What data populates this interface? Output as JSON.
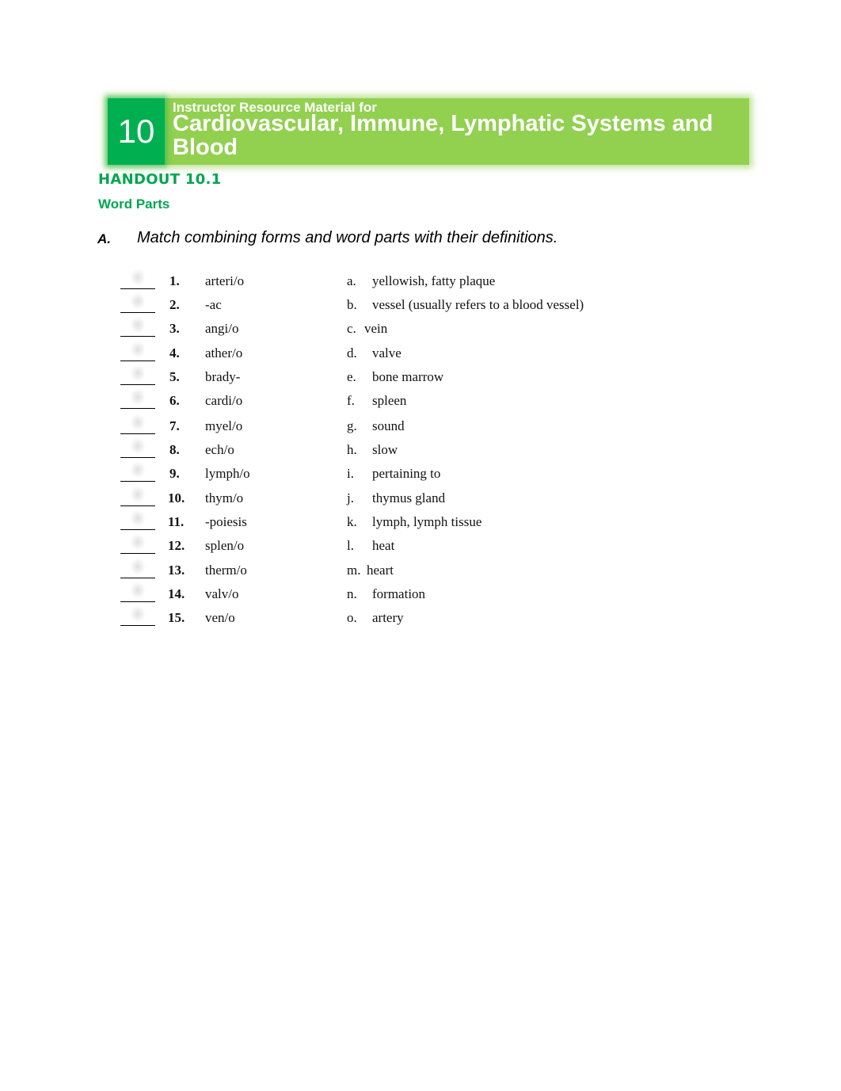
{
  "header": {
    "chapter_number": "10",
    "subtitle": "Instructor Resource Material for",
    "title": "Cardiovascular, Immune, Lymphatic Systems and Blood",
    "banner_color": "#92d050",
    "chapter_box_color": "#00b050"
  },
  "handout": {
    "label": "HANDOUT 10.1",
    "section_title": "Word Parts",
    "accent_color": "#00a650"
  },
  "exercise": {
    "letter": "A.",
    "instruction": "Match combining forms and word parts with their definitions.",
    "blank": "_____",
    "terms": [
      {
        "number": "1.",
        "term": "arteri/o"
      },
      {
        "number": "2.",
        "term": "-ac"
      },
      {
        "number": "3.",
        "term": "angi/o"
      },
      {
        "number": "4.",
        "term": "ather/o"
      },
      {
        "number": "5.",
        "term": "brady-"
      },
      {
        "number": "6.",
        "term": "cardi/o"
      },
      {
        "number": "7.",
        "term": "myel/o"
      },
      {
        "number": "8.",
        "term": "ech/o"
      },
      {
        "number": "9.",
        "term": "lymph/o"
      },
      {
        "number": "10.",
        "term": "thym/o"
      },
      {
        "number": "11.",
        "term": "-poiesis"
      },
      {
        "number": "12.",
        "term": "splen/o"
      },
      {
        "number": "13.",
        "term": "therm/o"
      },
      {
        "number": "14.",
        "term": "valv/o"
      },
      {
        "number": "15.",
        "term": "ven/o"
      }
    ],
    "definitions": [
      {
        "letter": "a.",
        "text": "yellowish, fatty plaque"
      },
      {
        "letter": "b.",
        "text": "vessel (usually refers to a blood vessel)"
      },
      {
        "letter": "c.",
        "text": "vein"
      },
      {
        "letter": "d.",
        "text": "valve"
      },
      {
        "letter": "e.",
        "text": "bone marrow"
      },
      {
        "letter": "f.",
        "text": "spleen"
      },
      {
        "letter": "g.",
        "text": "sound"
      },
      {
        "letter": "h.",
        "text": "slow"
      },
      {
        "letter": "i.",
        "text": "pertaining to"
      },
      {
        "letter": "j.",
        "text": "thymus gland"
      },
      {
        "letter": "k.",
        "text": "lymph, lymph tissue"
      },
      {
        "letter": "l.",
        "text": "heat"
      },
      {
        "letter": "m.",
        "text": "heart"
      },
      {
        "letter": "n.",
        "text": "formation"
      },
      {
        "letter": "o.",
        "text": "artery"
      }
    ]
  }
}
